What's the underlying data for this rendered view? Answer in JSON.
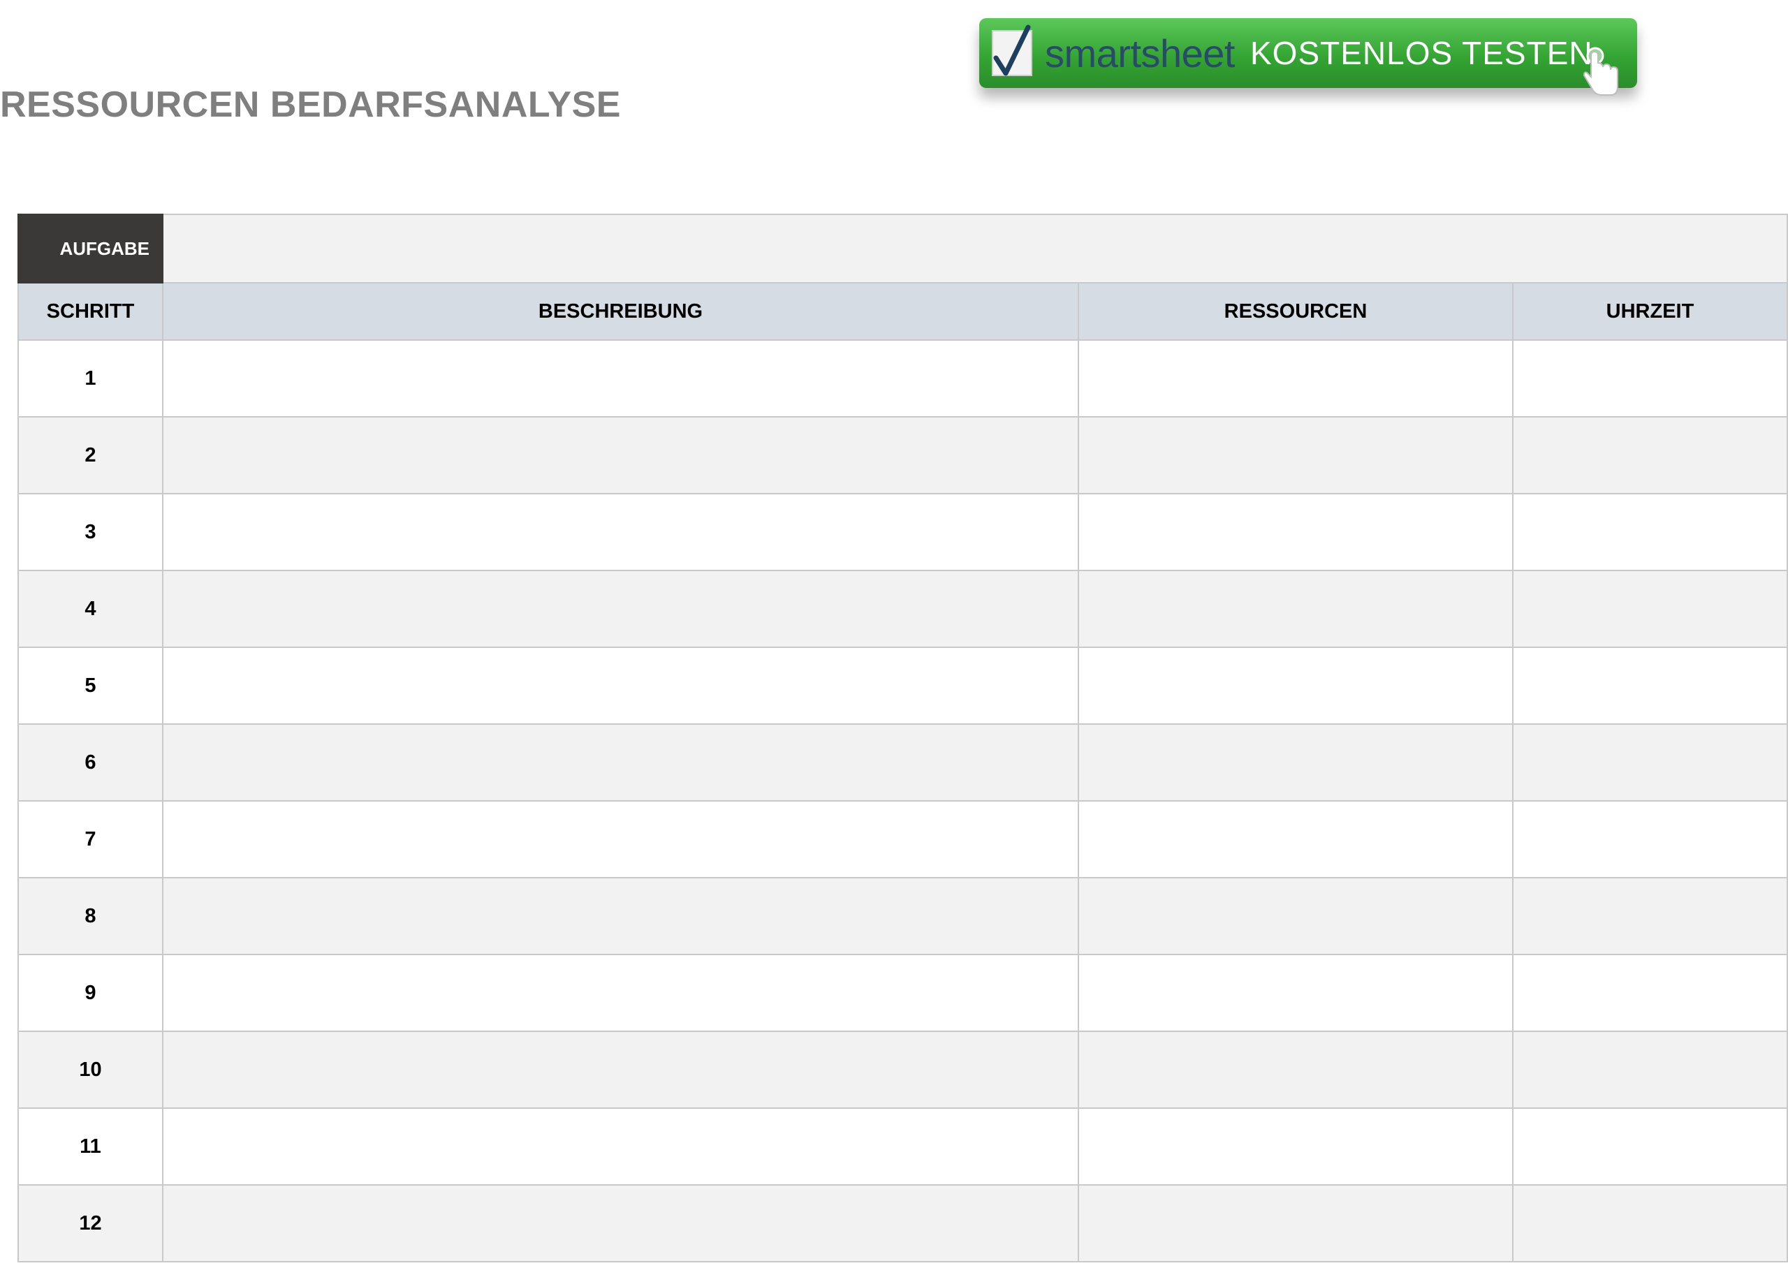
{
  "header": {
    "title": "RESSOURCEN BEDARFSANALYSE"
  },
  "banner": {
    "brand_part1": "smart",
    "brand_part2": "sheet",
    "cta": "KOSTENLOS TESTEN",
    "icons": [
      "checkmark-icon",
      "hand-pointer-icon"
    ],
    "colors": {
      "green": "#35a534",
      "brand_text": "#2a4a6a"
    }
  },
  "table": {
    "task_label": "AUFGABE",
    "task_value": "",
    "columns": [
      "SCHRITT",
      "BESCHREIBUNG",
      "RESSOURCEN",
      "UHRZEIT"
    ],
    "rows": [
      {
        "step": "1",
        "description": "",
        "resources": "",
        "time": ""
      },
      {
        "step": "2",
        "description": "",
        "resources": "",
        "time": ""
      },
      {
        "step": "3",
        "description": "",
        "resources": "",
        "time": ""
      },
      {
        "step": "4",
        "description": "",
        "resources": "",
        "time": ""
      },
      {
        "step": "5",
        "description": "",
        "resources": "",
        "time": ""
      },
      {
        "step": "6",
        "description": "",
        "resources": "",
        "time": ""
      },
      {
        "step": "7",
        "description": "",
        "resources": "",
        "time": ""
      },
      {
        "step": "8",
        "description": "",
        "resources": "",
        "time": ""
      },
      {
        "step": "9",
        "description": "",
        "resources": "",
        "time": ""
      },
      {
        "step": "10",
        "description": "",
        "resources": "",
        "time": ""
      },
      {
        "step": "11",
        "description": "",
        "resources": "",
        "time": ""
      },
      {
        "step": "12",
        "description": "",
        "resources": "",
        "time": ""
      }
    ],
    "colors": {
      "header_bg": "#d6dce4",
      "task_label_bg": "#3b3838",
      "alt_row_bg": "#f2f2f2",
      "border": "#c9c9c9",
      "title_gray": "#7f7f7f"
    }
  }
}
